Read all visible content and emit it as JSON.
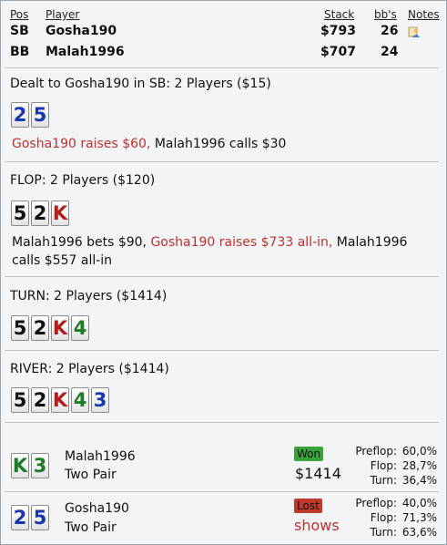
{
  "header": {
    "pos": "Pos",
    "player": "Player",
    "stack": "Stack",
    "bbs": "bb's",
    "notes": "Notes"
  },
  "players": [
    {
      "pos": "SB",
      "name": "Gosha190",
      "stack": "$793",
      "bbs": "26",
      "has_note": true
    },
    {
      "pos": "BB",
      "name": "Malah1996",
      "stack": "$707",
      "bbs": "24",
      "has_note": false
    }
  ],
  "preflop": {
    "title": "Dealt to Gosha190 in SB: 2 Players ($15)",
    "cards": [
      {
        "rank": "2",
        "suit": "d"
      },
      {
        "rank": "5",
        "suit": "d"
      }
    ],
    "action_hero": "Gosha190 raises $60,",
    "action_rest": " Malah1996 calls $30"
  },
  "flop": {
    "title": "FLOP: 2 Players ($120)",
    "cards": [
      {
        "rank": "5",
        "suit": "s"
      },
      {
        "rank": "2",
        "suit": "s"
      },
      {
        "rank": "K",
        "suit": "h"
      }
    ],
    "action_a": "Malah1996 bets $90, ",
    "action_hero": "Gosha190 raises $733 all-in,",
    "action_b": " Malah1996 calls $557 all-in"
  },
  "turn": {
    "title": "TURN: 2 Players ($1414)",
    "cards": [
      {
        "rank": "5",
        "suit": "s"
      },
      {
        "rank": "2",
        "suit": "s"
      },
      {
        "rank": "K",
        "suit": "h"
      },
      {
        "rank": "4",
        "suit": "c"
      }
    ]
  },
  "river": {
    "title": "RIVER: 2 Players ($1414)",
    "cards": [
      {
        "rank": "5",
        "suit": "s"
      },
      {
        "rank": "2",
        "suit": "s"
      },
      {
        "rank": "K",
        "suit": "h"
      },
      {
        "rank": "4",
        "suit": "c"
      },
      {
        "rank": "3",
        "suit": "d"
      }
    ]
  },
  "showdown": [
    {
      "cards": [
        {
          "rank": "K",
          "suit": "c"
        },
        {
          "rank": "3",
          "suit": "c"
        }
      ],
      "name": "Malah1996",
      "hand": "Two Pair",
      "badge": "Won",
      "result_color": "#3aa33a",
      "amount": "$1414",
      "eq_labels": [
        "Preflop:",
        "Flop:",
        "Turn:"
      ],
      "eq_values": [
        "60,0%",
        "28,7%",
        "36,4%"
      ]
    },
    {
      "cards": [
        {
          "rank": "2",
          "suit": "d"
        },
        {
          "rank": "5",
          "suit": "d"
        }
      ],
      "name": "Gosha190",
      "hand": "Two Pair",
      "badge": "Lost",
      "result_color": "#c0392b",
      "amount": "shows",
      "eq_labels": [
        "Preflop:",
        "Flop:",
        "Turn:"
      ],
      "eq_values": [
        "40,0%",
        "71,3%",
        "63,6%"
      ]
    }
  ],
  "colors": {
    "hero": "#c03030",
    "spade": "#111111",
    "heart": "#b01e1e",
    "diamond": "#1a35b0",
    "club": "#1f7a2a"
  },
  "icons": {
    "note": "notes-user-icon"
  }
}
